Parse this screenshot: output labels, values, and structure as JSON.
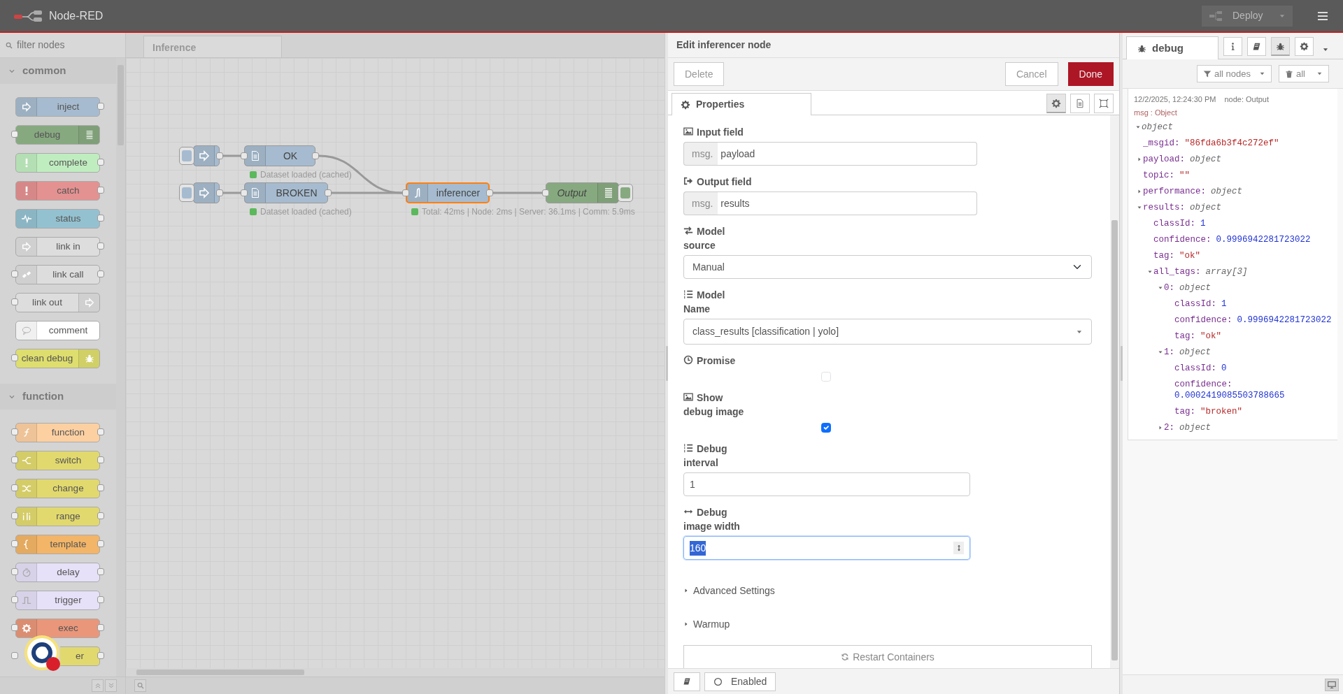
{
  "header": {
    "title": "Node-RED",
    "deploy": {
      "label": "Deploy",
      "disabled": true
    }
  },
  "palette": {
    "filter_placeholder": "filter nodes",
    "categories": [
      {
        "label": "common",
        "expanded": true,
        "nodes": [
          {
            "label": "inject",
            "color": "#a6bbcf",
            "inputs": false,
            "outputs": true
          },
          {
            "label": "debug",
            "color": "#87a980",
            "inputs": true,
            "outputs": false
          },
          {
            "label": "complete",
            "color": "#c0edc0",
            "inputs": false,
            "outputs": true
          },
          {
            "label": "catch",
            "color": "#e49191",
            "inputs": false,
            "outputs": true
          },
          {
            "label": "status",
            "color": "#94c1d0",
            "inputs": false,
            "outputs": true
          },
          {
            "label": "link in",
            "color": "#dddddd",
            "inputs": false,
            "outputs": true
          },
          {
            "label": "link call",
            "color": "#dddddd",
            "inputs": true,
            "outputs": true
          },
          {
            "label": "link out",
            "color": "#dddddd",
            "inputs": true,
            "outputs": false
          },
          {
            "label": "comment",
            "color": "#ffffff",
            "inputs": false,
            "outputs": false
          },
          {
            "label": "clean debug",
            "color": "#dede6e",
            "inputs": true,
            "outputs": false
          }
        ]
      },
      {
        "label": "function",
        "expanded": true,
        "nodes": [
          {
            "label": "function",
            "color": "#fdd0a2",
            "inputs": true,
            "outputs": true
          },
          {
            "label": "switch",
            "color": "#e2d96e",
            "inputs": true,
            "outputs": true
          },
          {
            "label": "change",
            "color": "#e2d96e",
            "inputs": true,
            "outputs": true
          },
          {
            "label": "range",
            "color": "#e2d96e",
            "inputs": true,
            "outputs": true
          },
          {
            "label": "template",
            "color": "#f3b567",
            "inputs": true,
            "outputs": true
          },
          {
            "label": "delay",
            "color": "#e6e0f8",
            "inputs": true,
            "outputs": true
          },
          {
            "label": "trigger",
            "color": "#e6e0f8",
            "inputs": true,
            "outputs": true
          },
          {
            "label": "exec",
            "color": "#e9967a",
            "inputs": true,
            "outputs": true
          },
          {
            "label": "er",
            "color": "#e2d96e",
            "inputs": true,
            "outputs": true
          }
        ]
      }
    ]
  },
  "workspace": {
    "tabs": [
      {
        "label": "Inference",
        "selected": true
      }
    ],
    "nodes": [
      {
        "kind": "inject",
        "color": "#a6bbcf",
        "selected": false
      },
      {
        "kind": "file",
        "label": "OK",
        "color": "#a6bbcf",
        "selected": false,
        "status": {
          "text": "Dataset loaded (cached)",
          "color": "#5cb85c"
        }
      },
      {
        "kind": "inject",
        "color": "#a6bbcf",
        "selected": false
      },
      {
        "kind": "file",
        "label": "BROKEN",
        "color": "#a6bbcf",
        "selected": false,
        "status": {
          "text": "Dataset loaded (cached)",
          "color": "#5cb85c"
        }
      },
      {
        "kind": "function",
        "label": "inferencer",
        "color": "#a6bbcf",
        "selected": true,
        "status": {
          "text": "Total: 42ms | Node: 2ms | Server: 36.1ms | Comm: 5.9ms",
          "color": "#5cb85c"
        }
      },
      {
        "kind": "debug",
        "label": "Output",
        "color": "#87a980",
        "selected": false
      }
    ]
  },
  "editor": {
    "title": "Edit inferencer node",
    "delete": "Delete",
    "cancel": "Cancel",
    "done": "Done",
    "tabs": [
      {
        "label": "Properties",
        "selected": true
      }
    ],
    "panel_buttons": [
      {
        "selected": true
      },
      {
        "selected": false
      },
      {
        "selected": false
      }
    ],
    "fields": [
      {
        "kind": "typed",
        "label": "Input field",
        "prefix": "msg.",
        "value": "payload"
      },
      {
        "kind": "typed",
        "label": "Output field",
        "prefix": "msg.",
        "value": "results"
      },
      {
        "kind": "select",
        "label": "Model source",
        "value": "Manual"
      },
      {
        "kind": "combo",
        "label": "Model Name",
        "value": "class_results [classification | yolo]"
      },
      {
        "kind": "checkbox",
        "label": "Promise",
        "checked": false
      },
      {
        "kind": "checkbox",
        "label": "Show debug image",
        "checked": true
      },
      {
        "kind": "text",
        "label": "Debug interval",
        "value": "1"
      },
      {
        "kind": "number",
        "label": "Debug image width",
        "value": "160"
      }
    ],
    "sections": [
      {
        "label": "Advanced Settings",
        "expanded": false
      },
      {
        "label": "Warmup",
        "expanded": false
      }
    ],
    "restart": "Restart Containers",
    "enabled": "Enabled"
  },
  "sidebar": {
    "tabs": [
      {
        "label": "debug",
        "selected": true
      }
    ],
    "tool_buttons": [
      {
        "selected": false
      },
      {
        "selected": false
      },
      {
        "selected": true
      },
      {
        "selected": false
      }
    ],
    "filter": "all nodes",
    "clear": "all",
    "messages": [
      {
        "time": "12/2/2025, 12:24:30 PM",
        "source": "node: Output",
        "type": "msg : Object",
        "tree": {
          "value": "object",
          "kind": "type",
          "expanded": true,
          "children": [
            {
              "key": "_msgid:",
              "value": "\"86fda6b3f4c272ef\"",
              "kind": "string"
            },
            {
              "key": "payload:",
              "value": "object",
              "kind": "type",
              "expanded": false
            },
            {
              "key": "topic:",
              "value": "\"\"",
              "kind": "string"
            },
            {
              "key": "performance:",
              "value": "object",
              "kind": "type",
              "expanded": false
            },
            {
              "key": "results:",
              "value": "object",
              "kind": "type",
              "expanded": true,
              "children": [
                {
                  "key": "classId:",
                  "value": "1",
                  "kind": "number"
                },
                {
                  "key": "confidence:",
                  "value": "0.9996942281723022",
                  "kind": "number"
                },
                {
                  "key": "tag:",
                  "value": "\"ok\"",
                  "kind": "string"
                },
                {
                  "key": "all_tags:",
                  "value": "array[3]",
                  "kind": "type",
                  "expanded": true,
                  "children": [
                    {
                      "key": "0:",
                      "value": "object",
                      "kind": "type",
                      "expanded": true,
                      "children": [
                        {
                          "key": "classId:",
                          "value": "1",
                          "kind": "number"
                        },
                        {
                          "key": "confidence:",
                          "value": "0.9996942281723022",
                          "kind": "number"
                        },
                        {
                          "key": "tag:",
                          "value": "\"ok\"",
                          "kind": "string"
                        }
                      ]
                    },
                    {
                      "key": "1:",
                      "value": "object",
                      "kind": "type",
                      "expanded": true,
                      "children": [
                        {
                          "key": "classId:",
                          "value": "0",
                          "kind": "number"
                        },
                        {
                          "key": "confidence:",
                          "value": "0.0002419085503788665",
                          "kind": "number"
                        },
                        {
                          "key": "tag:",
                          "value": "\"broken\"",
                          "kind": "string"
                        }
                      ]
                    },
                    {
                      "key": "2:",
                      "value": "object",
                      "kind": "type",
                      "expanded": false
                    }
                  ]
                }
              ]
            }
          ]
        }
      }
    ]
  }
}
